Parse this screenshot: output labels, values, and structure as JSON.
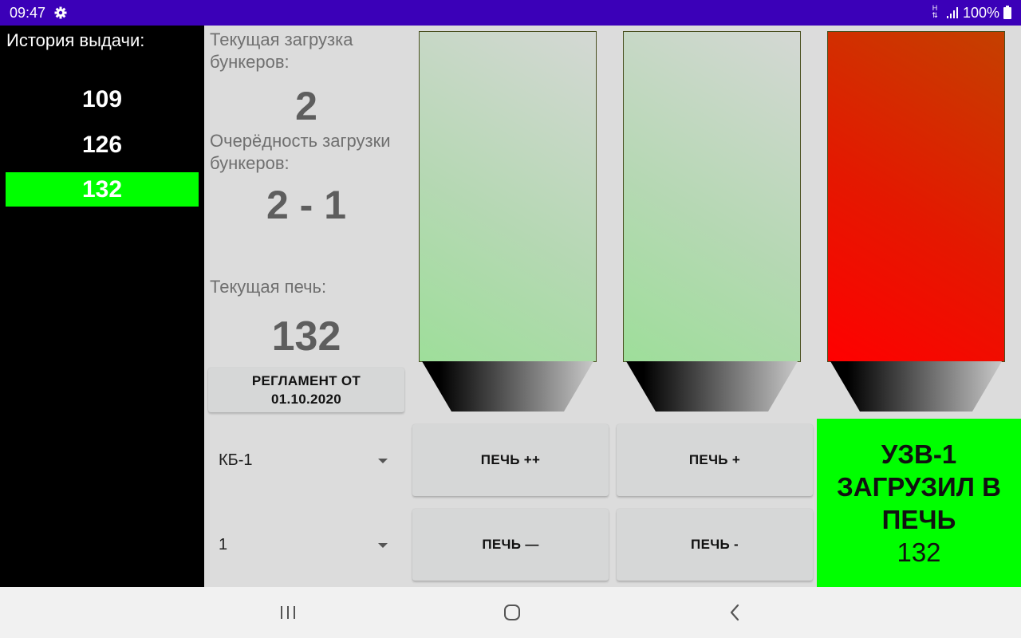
{
  "status_bar": {
    "time": "09:47",
    "network_type": "H",
    "battery_percent": "100%",
    "background_color": "#3b00b8",
    "icons": [
      "gear-icon",
      "signal-icon",
      "battery-icon"
    ]
  },
  "history": {
    "title": "История выдачи:",
    "items": [
      "109",
      "126",
      "132"
    ],
    "active_item": "132",
    "active_color": "#00ff00"
  },
  "info": {
    "current_load_label": "Текущая загрузка бункеров:",
    "current_load_value": "2",
    "order_label": "Очерёдность загрузки бункеров:",
    "order_value": "2 - 1",
    "current_furnace_label": "Текущая печь:",
    "current_furnace_value": "132",
    "regulation_button": "РЕГЛАМЕНТ ОТ 01.10.2020"
  },
  "dropdowns": {
    "unit": {
      "selected": "КБ-1"
    },
    "number": {
      "selected": "1"
    }
  },
  "buttons": {
    "furnace_plus_plus": "ПЕЧЬ ++",
    "furnace_plus": "ПЕЧЬ +",
    "furnace_minus_minus": "ПЕЧЬ —",
    "furnace_minus": "ПЕЧЬ -"
  },
  "hoppers": [
    {
      "state": "green"
    },
    {
      "state": "green"
    },
    {
      "state": "red"
    }
  ],
  "status_panel": {
    "line1": "УЗВ-1",
    "line2": "ЗАГРУЗИЛ В",
    "line3": "ПЕЧЬ",
    "line4": "132",
    "color": "#00ff00"
  },
  "nav_bar": {
    "icons": [
      "recent-apps-icon",
      "home-icon",
      "back-icon"
    ]
  }
}
